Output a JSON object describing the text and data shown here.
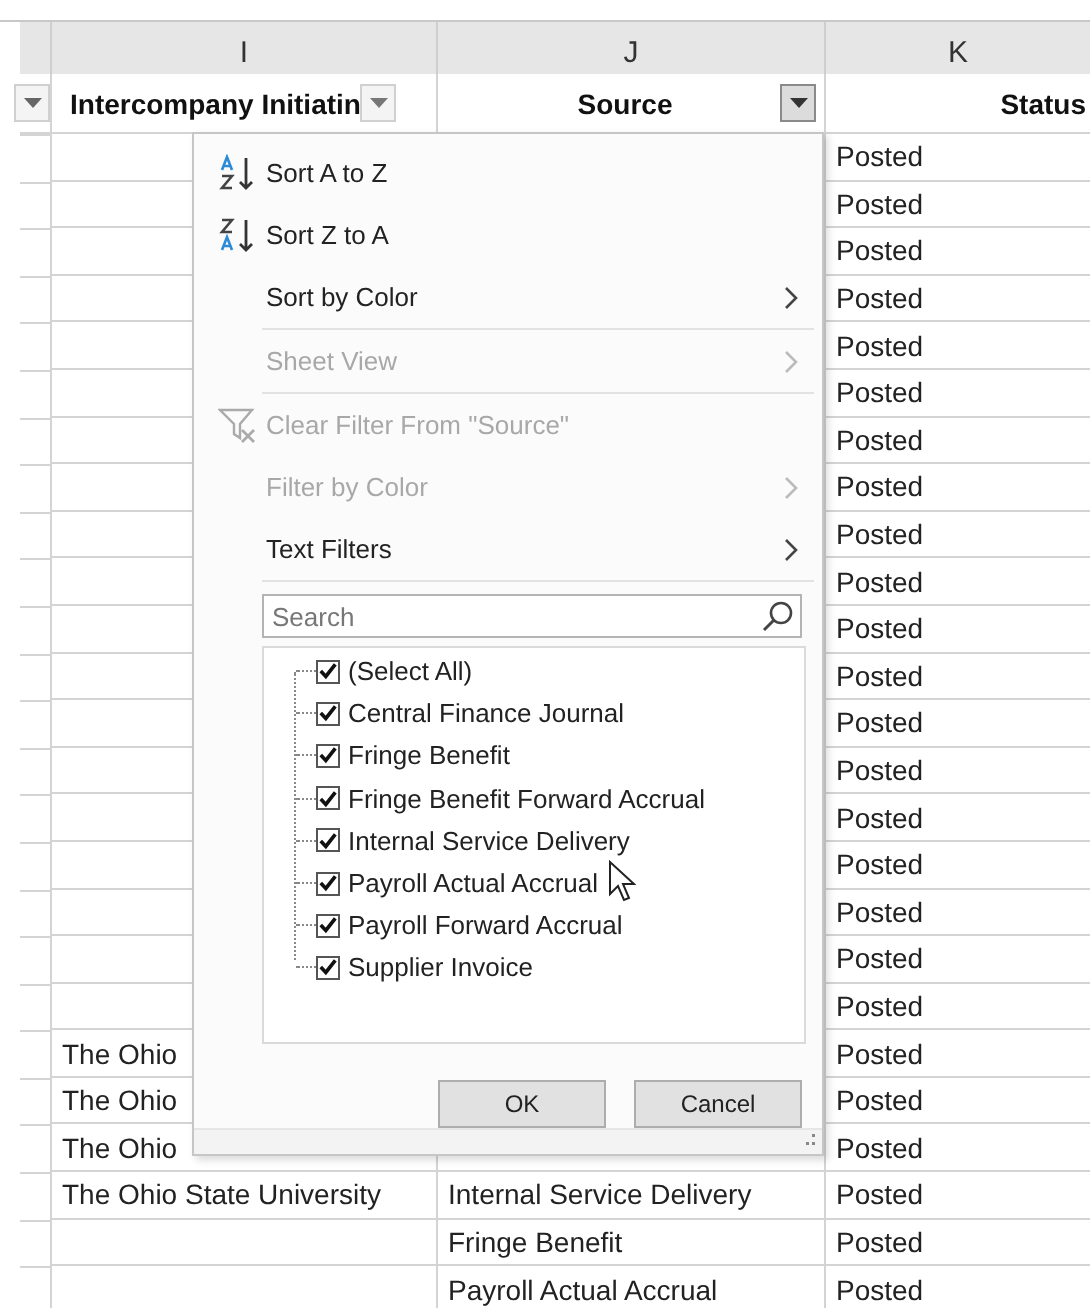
{
  "columns": [
    {
      "letter": "I",
      "header": "Intercompany Initiatin",
      "filter_open": false
    },
    {
      "letter": "J",
      "header": "Source",
      "filter_open": true
    },
    {
      "letter": "K",
      "header": "Status"
    }
  ],
  "rows": [
    {
      "cells": [
        "",
        "",
        "Posted"
      ]
    },
    {
      "cells": [
        "",
        "",
        "Posted"
      ]
    },
    {
      "cells": [
        "",
        "",
        "Posted"
      ]
    },
    {
      "cells": [
        "",
        "",
        "Posted"
      ]
    },
    {
      "cells": [
        "",
        "",
        "Posted"
      ]
    },
    {
      "cells": [
        "",
        "",
        "Posted"
      ]
    },
    {
      "cells": [
        "",
        "",
        "Posted"
      ]
    },
    {
      "cells": [
        "",
        "",
        "Posted"
      ]
    },
    {
      "cells": [
        "",
        "",
        "Posted"
      ]
    },
    {
      "cells": [
        "",
        "",
        "Posted"
      ]
    },
    {
      "cells": [
        "",
        "",
        "Posted"
      ]
    },
    {
      "cells": [
        "",
        "",
        "Posted"
      ]
    },
    {
      "cells": [
        "",
        "",
        "Posted"
      ]
    },
    {
      "cells": [
        "",
        "",
        "Posted"
      ]
    },
    {
      "cells": [
        "",
        "",
        "Posted"
      ]
    },
    {
      "cells": [
        "",
        "",
        "Posted"
      ]
    },
    {
      "cells": [
        "",
        "",
        "Posted"
      ]
    },
    {
      "cells": [
        "",
        "",
        "Posted"
      ]
    },
    {
      "cells": [
        "",
        "",
        "Posted"
      ]
    },
    {
      "cells": [
        "The Ohio",
        "",
        "Posted"
      ]
    },
    {
      "cells": [
        "The Ohio",
        "",
        "Posted"
      ]
    },
    {
      "cells": [
        "The Ohio",
        "",
        "Posted"
      ]
    },
    {
      "cells": [
        "The Ohio State University",
        "Internal Service Delivery",
        "Posted"
      ]
    },
    {
      "cells": [
        "",
        "Fringe Benefit",
        "Posted"
      ]
    },
    {
      "cells": [
        "",
        "Payroll Actual Accrual",
        "Posted"
      ]
    }
  ],
  "filter_menu": {
    "groups": [
      [
        {
          "kind": "sort_asc",
          "label": "Sort A to Z",
          "disabled": false
        },
        {
          "kind": "sort_desc",
          "label": "Sort Z to A",
          "disabled": false
        },
        {
          "kind": "submenu",
          "label": "Sort by Color",
          "disabled": false
        }
      ],
      [
        {
          "kind": "submenu",
          "label": "Sheet View",
          "disabled": true
        }
      ],
      [
        {
          "kind": "clear_filter",
          "label": "Clear Filter From \"Source\"",
          "disabled": true
        },
        {
          "kind": "submenu",
          "label": "Filter by Color",
          "disabled": true
        },
        {
          "kind": "submenu",
          "label": "Text Filters",
          "disabled": false
        }
      ]
    ],
    "search": {
      "placeholder": "Search"
    },
    "values": [
      {
        "label": "(Select All)",
        "checked": true
      },
      {
        "label": "Central Finance Journal",
        "checked": true
      },
      {
        "label": "Fringe Benefit",
        "checked": true
      },
      {
        "label": "Fringe Benefit Forward Accrual",
        "checked": true
      },
      {
        "label": "Internal Service Delivery",
        "checked": true
      },
      {
        "label": "Payroll Actual Accrual",
        "checked": true
      },
      {
        "label": "Payroll Forward Accrual",
        "checked": true
      },
      {
        "label": "Supplier Invoice",
        "checked": true
      }
    ],
    "buttons": [
      "OK",
      "Cancel"
    ]
  }
}
